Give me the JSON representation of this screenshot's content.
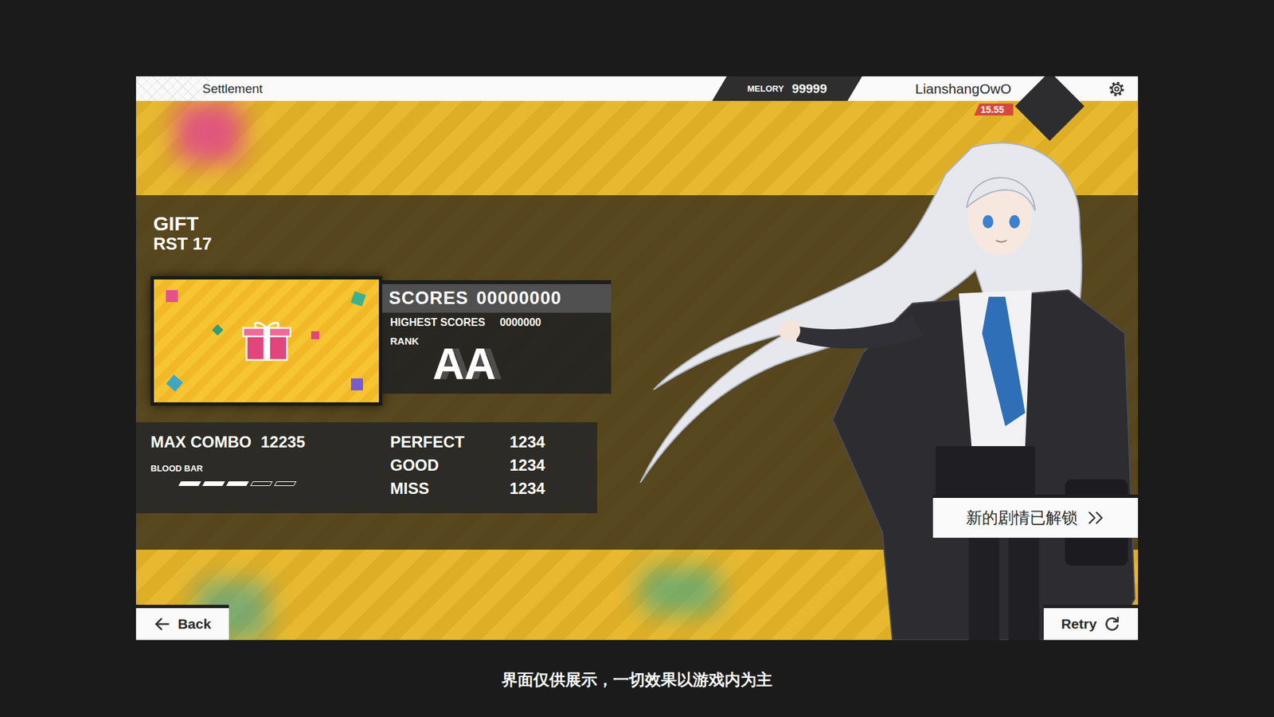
{
  "topbar": {
    "title": "Settlement",
    "currency": {
      "label": "MELORY",
      "value": "99999"
    },
    "user": {
      "name": "LianshangOwO",
      "rating": "15.55"
    }
  },
  "song": {
    "title": "GIFT",
    "difficulty": "RST 17"
  },
  "score": {
    "label": "SCORES",
    "value": "00000000",
    "highest_label": "HIGHEST SCORES",
    "highest_value": "0000000",
    "rank_label": "RANK",
    "rank": "AA"
  },
  "combo": {
    "label": "MAX COMBO",
    "value": "12235"
  },
  "blood_bar": {
    "label": "BLOOD BAR",
    "segments": [
      {
        "filled": true
      },
      {
        "filled": true
      },
      {
        "filled": true
      },
      {
        "filled": false
      },
      {
        "filled": false
      }
    ]
  },
  "judgements": [
    {
      "label": "PERFECT",
      "value": "1234"
    },
    {
      "label": "GOOD",
      "value": "1234"
    },
    {
      "label": "MISS",
      "value": "1234"
    }
  ],
  "story_button": {
    "label": "新的剧情已解锁"
  },
  "buttons": [
    {
      "label": "Back",
      "kind": "back"
    },
    {
      "label": "Retry",
      "kind": "retry"
    }
  ],
  "caption": "界面仅供展示，一切效果以游戏内为主"
}
